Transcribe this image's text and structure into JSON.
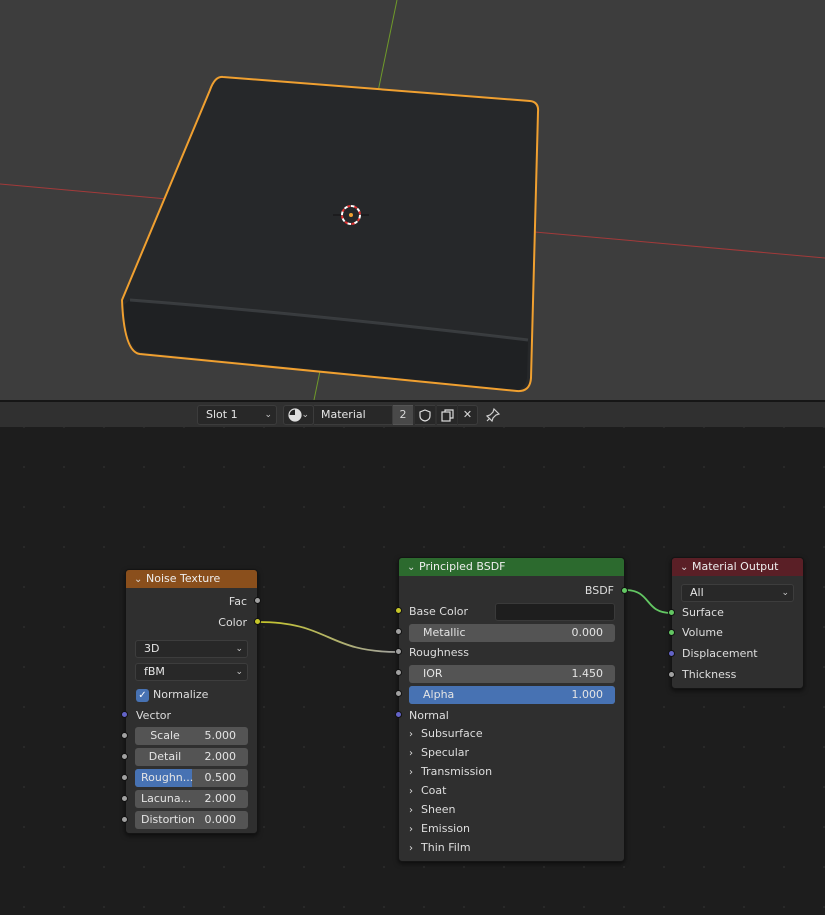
{
  "header": {
    "slot": "Slot 1",
    "material_name": "Material",
    "user_count": "2",
    "browse_icon": "sphere-icon",
    "icons": [
      "shield-icon",
      "duplicate-icon",
      "close-icon",
      "pin-icon"
    ]
  },
  "colors": {
    "viewport_bg": "#3d3d3d",
    "selection_outline": "#f0a030",
    "x_axis": "#a33a3a",
    "y_axis": "#6f9a2a",
    "texture_header": "#8a4f1c",
    "shader_header": "#2c6a2e",
    "output_header": "#5a1f26",
    "socket_float": "#a1a1a1",
    "socket_color": "#c7c729",
    "socket_vector": "#6363c7",
    "socket_shader": "#63c763",
    "slider_fill": "#4772b3"
  },
  "nodes": {
    "noise": {
      "title": "Noise Texture",
      "outputs": [
        "Fac",
        "Color"
      ],
      "dimensions": "3D",
      "type": "fBM",
      "normalize_label": "Normalize",
      "normalize_checked": true,
      "vector_label": "Vector",
      "fields": [
        {
          "label": "Scale",
          "value": "5.000"
        },
        {
          "label": "Detail",
          "value": "2.000"
        },
        {
          "label": "Roughn...",
          "value": "0.500",
          "fraction": 0.5
        },
        {
          "label": "Lacuna...",
          "value": "2.000"
        },
        {
          "label": "Distortion",
          "value": "0.000"
        }
      ]
    },
    "bsdf": {
      "title": "Principled BSDF",
      "output": "BSDF",
      "base_color": "Base Color",
      "metallic": {
        "label": "Metallic",
        "value": "0.000"
      },
      "roughness": "Roughness",
      "ior": {
        "label": "IOR",
        "value": "1.450"
      },
      "alpha": {
        "label": "Alpha",
        "value": "1.000",
        "fraction": 1.0
      },
      "normal": "Normal",
      "panels": [
        "Subsurface",
        "Specular",
        "Transmission",
        "Coat",
        "Sheen",
        "Emission",
        "Thin Film"
      ]
    },
    "output": {
      "title": "Material Output",
      "target": "All",
      "inputs": [
        "Surface",
        "Volume",
        "Displacement",
        "Thickness"
      ]
    }
  }
}
